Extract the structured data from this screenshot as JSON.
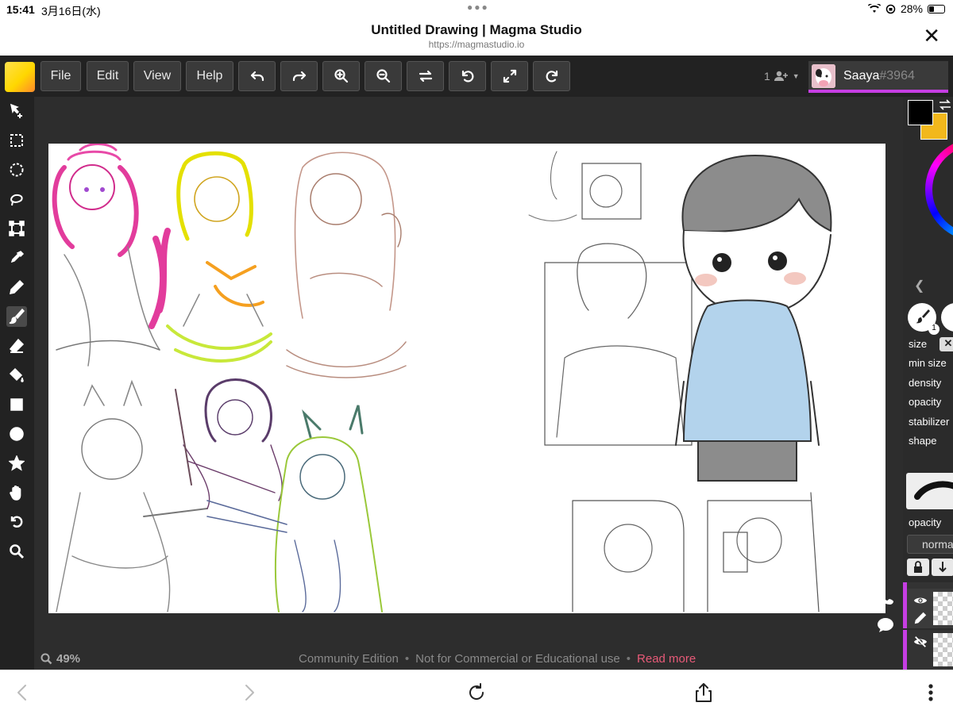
{
  "status_bar": {
    "time": "15:41",
    "date": "3月16日(水)",
    "battery": "28%",
    "battery_level": 0.28
  },
  "browser": {
    "title": "Untitled Drawing | Magma Studio",
    "url": "https://magmastudio.io",
    "close_icon": "close-icon"
  },
  "menu": {
    "file": "File",
    "edit": "Edit",
    "view": "View",
    "help": "Help"
  },
  "toolbar_icons": [
    "undo-icon",
    "redo-icon",
    "zoom-in-icon",
    "zoom-out-icon",
    "flip-icon",
    "rotate-left-icon",
    "fullscreen-icon",
    "rotate-right-icon"
  ],
  "users": {
    "count": "1",
    "name": "Saaya",
    "tag": "#3964"
  },
  "left_tools": [
    "move-icon",
    "rect-select-icon",
    "ellipse-select-icon",
    "lasso-icon",
    "transform-icon",
    "eyedropper-icon",
    "pencil-icon",
    "brush-icon",
    "eraser-icon",
    "fill-icon",
    "rectangle-icon",
    "circle-icon",
    "star-icon",
    "hand-icon",
    "rotate-view-icon",
    "zoom-icon"
  ],
  "status": {
    "zoom": "49%"
  },
  "footer": {
    "edition": "Community Edition",
    "notice": "Not for Commercial or Educational use",
    "read_more": "Read more",
    "separator": "•"
  },
  "panel": {
    "colors": {
      "primary": "#000000",
      "secondary": "#f2b81c",
      "accent": "#c63ee3"
    },
    "brush_number": "1",
    "labels": {
      "size": "size",
      "min_size": "min size",
      "density": "density",
      "opacity": "opacity",
      "stabilizer": "stabilizer",
      "shape": "shape",
      "layer_opacity": "opacity"
    },
    "size_reset": "✕",
    "blend_mode": "norma"
  }
}
